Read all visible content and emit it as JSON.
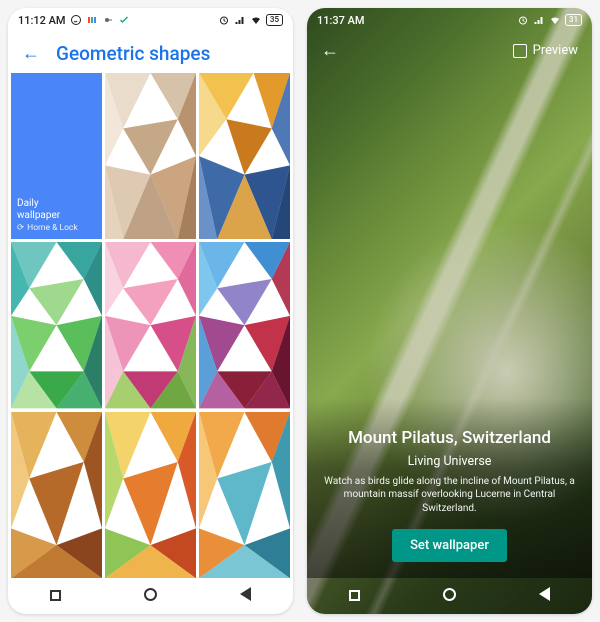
{
  "left": {
    "status": {
      "time": "11:12 AM",
      "battery": "35",
      "icons": [
        "whatsapp",
        "miui",
        "weather",
        "check"
      ],
      "right_icons": [
        "alarm",
        "signal",
        "wifi"
      ]
    },
    "title": "Geometric shapes",
    "daily": {
      "line1": "Daily",
      "line2": "wallpaper",
      "sub": "Home & Lock"
    }
  },
  "right": {
    "status": {
      "time": "11:37 AM",
      "battery": "31",
      "right_icons": [
        "alarm",
        "signal",
        "wifi"
      ]
    },
    "preview_label": "Preview",
    "title": "Mount Pilatus, Switzerland",
    "subtitle": "Living Universe",
    "description": "Watch as birds glide along the incline of Mount Pilatus, a mountain massif overlooking Lucerne in Central Switzerland.",
    "button": "Set wallpaper"
  },
  "colors": {
    "accent_blue": "#1a73e8",
    "teal": "#009688"
  }
}
